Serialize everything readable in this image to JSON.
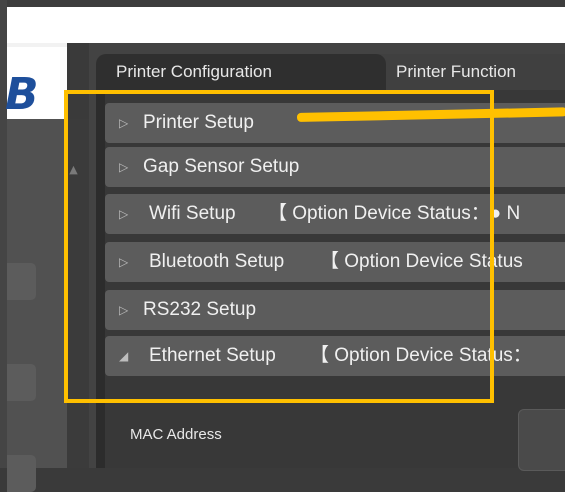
{
  "app": {
    "logo_text": "B",
    "brand_color": "#1e4f9b"
  },
  "tabs": [
    {
      "label": "Printer Configuration",
      "active": true
    },
    {
      "label": "Printer Function",
      "active": false
    }
  ],
  "sections": [
    {
      "label": "Printer Setup",
      "arrow": "▷",
      "status": ""
    },
    {
      "label": "Gap Sensor Setup",
      "arrow": "▷",
      "status": ""
    },
    {
      "label": "Wifi Setup",
      "arrow": "▷",
      "status": "【 Option Device Status：● N"
    },
    {
      "label": "Bluetooth Setup",
      "arrow": "▷",
      "status": "【 Option Device Status"
    },
    {
      "label": "RS232 Setup",
      "arrow": "▷",
      "status": ""
    },
    {
      "label": "Ethernet Setup",
      "arrow": "◢",
      "status": "【 Option Device Status："
    }
  ],
  "ethernet": {
    "mac_label": "MAC Address"
  },
  "annotation": {
    "highlight_color": "#ffc000"
  }
}
